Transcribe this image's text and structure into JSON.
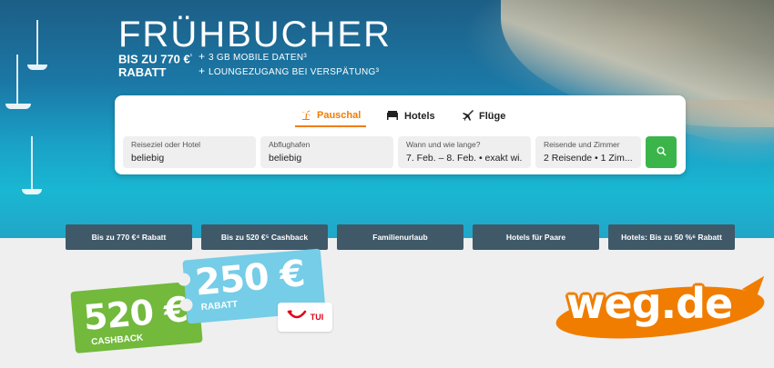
{
  "hero": {
    "title": "FRÜHBUCHER",
    "discount_line1": "BIS ZU 770 €",
    "discount_sup": "¹",
    "discount_line2": "RABATT",
    "features": [
      "3 GB MOBILE DATEN³",
      "LOUNGEZUGANG BEI VERSPÄTUNG³"
    ]
  },
  "search": {
    "tabs": [
      {
        "label": "Pauschal",
        "icon": "palm-icon",
        "active": true
      },
      {
        "label": "Hotels",
        "icon": "bed-icon",
        "active": false
      },
      {
        "label": "Flüge",
        "icon": "plane-icon",
        "active": false
      }
    ],
    "fields": [
      {
        "label": "Reiseziel oder Hotel",
        "value": "beliebig"
      },
      {
        "label": "Abflughafen",
        "value": "beliebig"
      },
      {
        "label": "Wann und wie lange?",
        "value": "7. Feb. – 8. Feb. • exakt wi..."
      },
      {
        "label": "Reisende und Zimmer",
        "value": "2 Reisende • 1 Zim..."
      }
    ],
    "button_icon": "search-icon"
  },
  "quick_links": [
    "Bis zu 770 €⁴ Rabatt",
    "Bis zu 520 €⁵ Cashback",
    "Familienurlaub",
    "Hotels für Paare",
    "Hotels: Bis zu 50 %⁶ Rabatt"
  ],
  "vouchers": {
    "green_amount": "520 €",
    "green_label": "CASHBACK",
    "blue_amount": "250 €",
    "blue_label": "RABATT",
    "brand": "TUI"
  },
  "logo": {
    "text": "weg.de"
  },
  "colors": {
    "accent": "#f07d00",
    "quick_bg": "#3f5969",
    "search_btn": "#3bb54a"
  }
}
